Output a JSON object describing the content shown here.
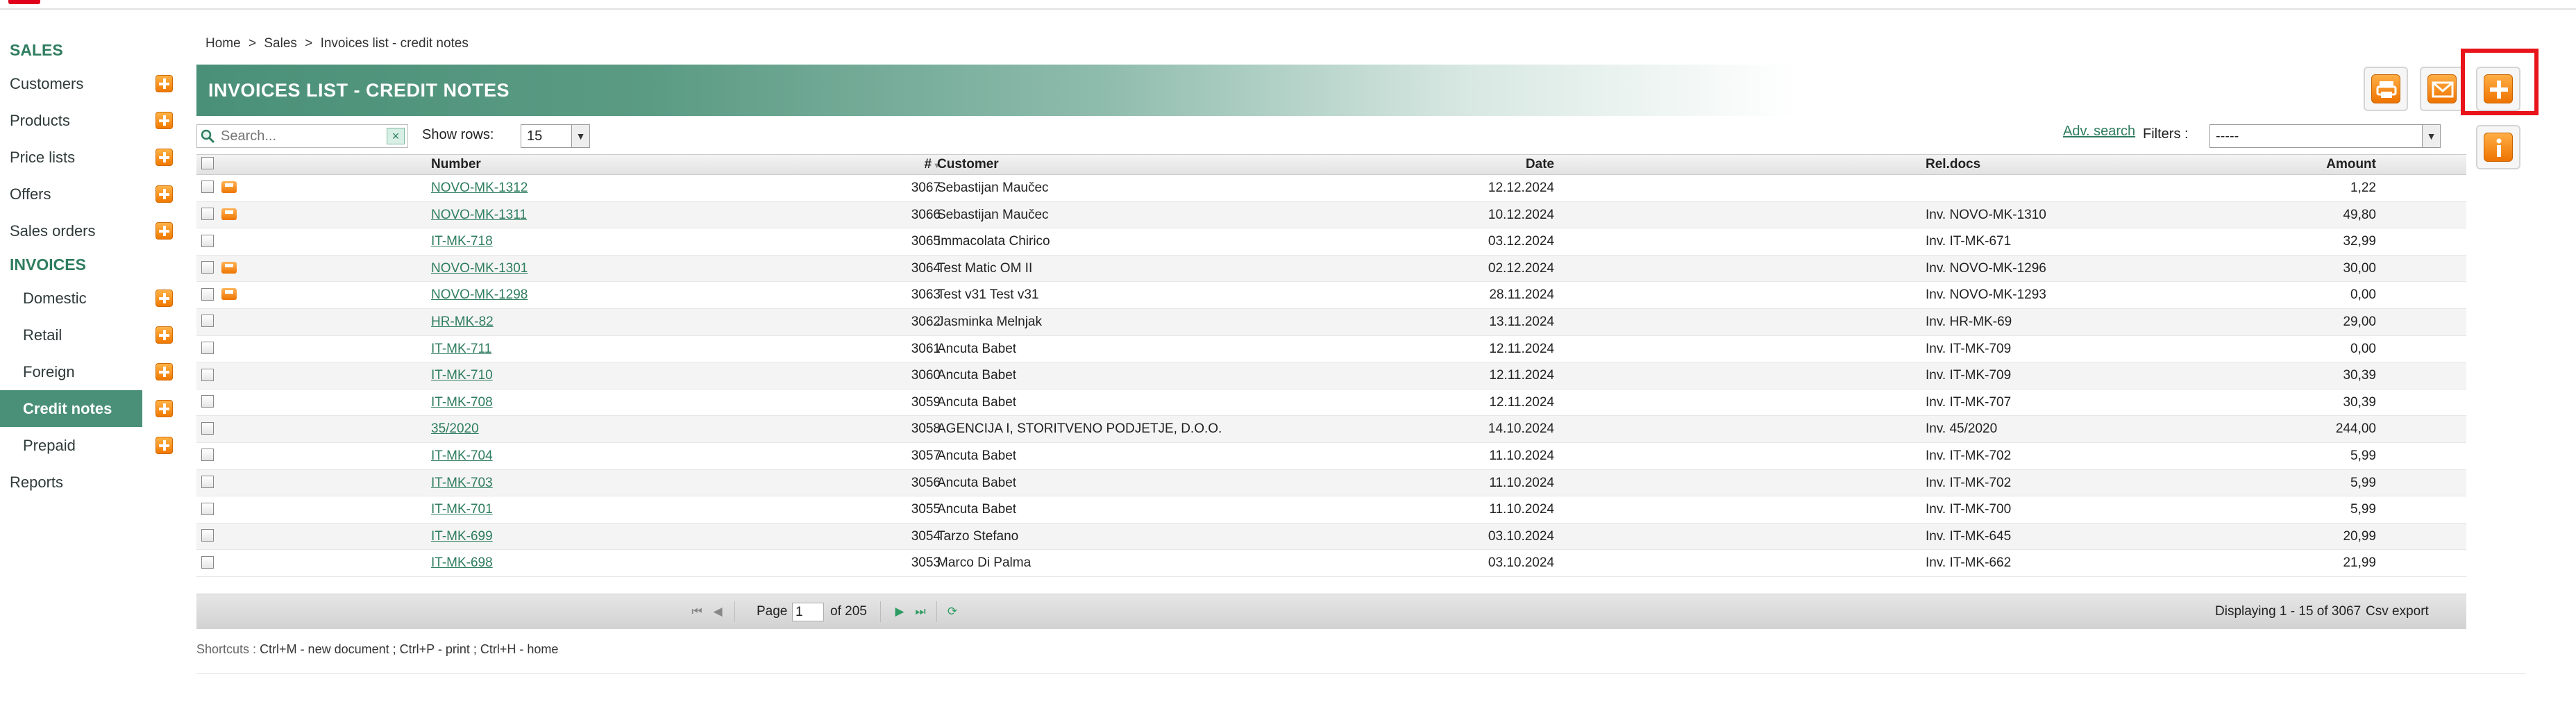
{
  "sidebar": {
    "sales_title": "SALES",
    "sales_items": [
      {
        "label": "Customers"
      },
      {
        "label": "Products"
      },
      {
        "label": "Price lists"
      },
      {
        "label": "Offers"
      },
      {
        "label": "Sales orders"
      }
    ],
    "invoices_title": "INVOICES",
    "invoice_items": [
      {
        "label": "Domestic"
      },
      {
        "label": "Retail"
      },
      {
        "label": "Foreign"
      },
      {
        "label": "Credit notes"
      },
      {
        "label": "Prepaid"
      }
    ],
    "reports_label": "Reports"
  },
  "breadcrumb": {
    "home": "Home",
    "sep1": ">",
    "sales": "Sales",
    "sep2": ">",
    "current": "Invoices list - credit notes"
  },
  "header": {
    "title": "INVOICES LIST - CREDIT NOTES"
  },
  "toolbar": {
    "search_placeholder": "Search...",
    "clear_label": "×",
    "show_rows_label": "Show rows:",
    "show_rows_value": "15",
    "adv_search_label": "Adv. search",
    "filters_label": "Filters :",
    "filters_value": "-----"
  },
  "table": {
    "headers": {
      "id": "#",
      "number": "Number",
      "date": "Date",
      "customer": "Customer",
      "rel_docs": "Rel.docs",
      "amount": "Amount"
    },
    "rows": [
      {
        "id": "3067",
        "number": "NOVO-MK-1312",
        "date": "12.12.2024",
        "customer": "Sebastijan Maučec",
        "rel_docs": "",
        "amount": "1,22",
        "printed": true
      },
      {
        "id": "3066",
        "number": "NOVO-MK-1311",
        "date": "10.12.2024",
        "customer": "Sebastijan Maučec",
        "rel_docs": "Inv. NOVO-MK-1310",
        "amount": "49,80",
        "printed": true
      },
      {
        "id": "3065",
        "number": "IT-MK-718",
        "date": "03.12.2024",
        "customer": "Immacolata Chirico",
        "rel_docs": "Inv. IT-MK-671",
        "amount": "32,99",
        "printed": false
      },
      {
        "id": "3064",
        "number": "NOVO-MK-1301",
        "date": "02.12.2024",
        "customer": "Test Matic OM II",
        "rel_docs": "Inv. NOVO-MK-1296",
        "amount": "30,00",
        "printed": true
      },
      {
        "id": "3063",
        "number": "NOVO-MK-1298",
        "date": "28.11.2024",
        "customer": "Test v31 Test v31",
        "rel_docs": "Inv. NOVO-MK-1293",
        "amount": "0,00",
        "printed": true
      },
      {
        "id": "3062",
        "number": "HR-MK-82",
        "date": "13.11.2024",
        "customer": "Jasminka Melnjak",
        "rel_docs": "Inv. HR-MK-69",
        "amount": "29,00",
        "printed": false
      },
      {
        "id": "3061",
        "number": "IT-MK-711",
        "date": "12.11.2024",
        "customer": "Ancuta Babet",
        "rel_docs": "Inv. IT-MK-709",
        "amount": "0,00",
        "printed": false
      },
      {
        "id": "3060",
        "number": "IT-MK-710",
        "date": "12.11.2024",
        "customer": "Ancuta Babet",
        "rel_docs": "Inv. IT-MK-709",
        "amount": "30,39",
        "printed": false
      },
      {
        "id": "3059",
        "number": "IT-MK-708",
        "date": "12.11.2024",
        "customer": "Ancuta Babet",
        "rel_docs": "Inv. IT-MK-707",
        "amount": "30,39",
        "printed": false
      },
      {
        "id": "3058",
        "number": "35/2020",
        "date": "14.10.2024",
        "customer": "AGENCIJA I, STORITVENO PODJETJE, D.O.O.",
        "rel_docs": "Inv. 45/2020",
        "amount": "244,00",
        "printed": false
      },
      {
        "id": "3057",
        "number": "IT-MK-704",
        "date": "11.10.2024",
        "customer": "Ancuta Babet",
        "rel_docs": "Inv. IT-MK-702",
        "amount": "5,99",
        "printed": false
      },
      {
        "id": "3056",
        "number": "IT-MK-703",
        "date": "11.10.2024",
        "customer": "Ancuta Babet",
        "rel_docs": "Inv. IT-MK-702",
        "amount": "5,99",
        "printed": false
      },
      {
        "id": "3055",
        "number": "IT-MK-701",
        "date": "11.10.2024",
        "customer": "Ancuta Babet",
        "rel_docs": "Inv. IT-MK-700",
        "amount": "5,99",
        "printed": false
      },
      {
        "id": "3054",
        "number": "IT-MK-699",
        "date": "03.10.2024",
        "customer": "Tarzo Stefano",
        "rel_docs": "Inv. IT-MK-645",
        "amount": "20,99",
        "printed": false
      },
      {
        "id": "3053",
        "number": "IT-MK-698",
        "date": "03.10.2024",
        "customer": "Marco Di Palma",
        "rel_docs": "Inv. IT-MK-662",
        "amount": "21,99",
        "printed": false
      }
    ]
  },
  "pager": {
    "page_label": "Page",
    "page_value": "1",
    "of_label": "of 205",
    "displaying": "Displaying 1 - 15 of 3067",
    "csv_export": "Csv export"
  },
  "shortcuts": {
    "label": "Shortcuts :",
    "text": "Ctrl+M - new document ;   Ctrl+P - print ;   Ctrl+H - home"
  },
  "actions": {
    "print_icon": "printer-icon",
    "email_icon": "envelope-icon",
    "add_icon": "plus-icon",
    "info_icon": "info-icon"
  }
}
